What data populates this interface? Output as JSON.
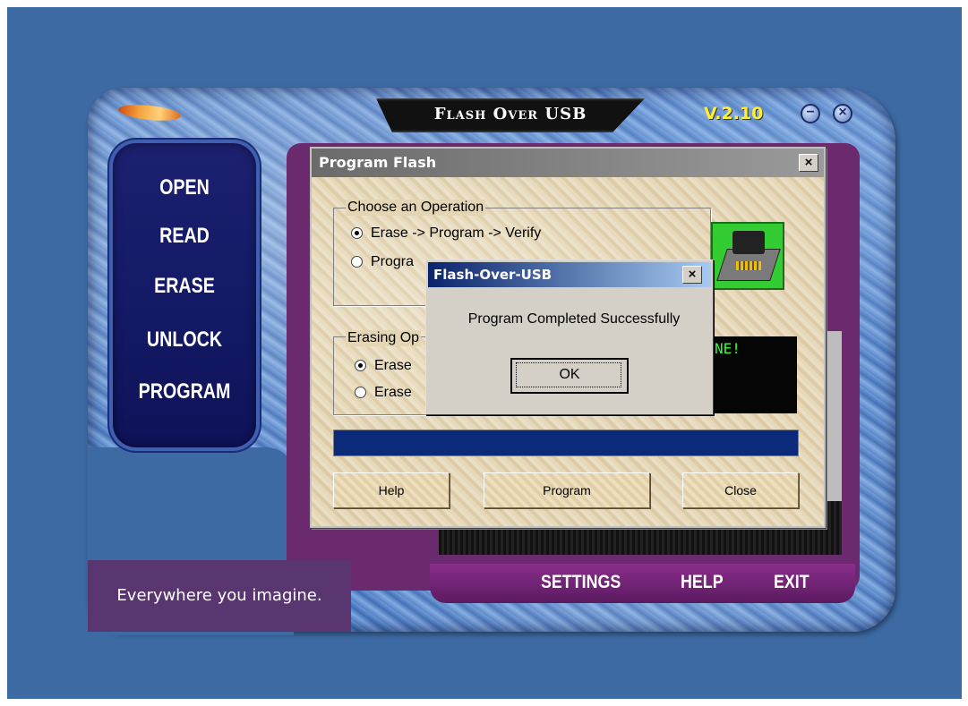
{
  "app": {
    "title": "Flash Over USB",
    "version": "V.2.10",
    "minimize_glyph": "−",
    "close_glyph": "×"
  },
  "nav": {
    "items": [
      {
        "label": "OPEN"
      },
      {
        "label": "READ"
      },
      {
        "label": "ERASE"
      },
      {
        "label": "UNLOCK"
      },
      {
        "label": "PROGRAM"
      }
    ]
  },
  "bottom_links": {
    "settings": "SETTINGS",
    "help": "HELP",
    "exit": "EXIT"
  },
  "slogan": "Everywhere you imagine.",
  "program_dialog": {
    "title": "Program Flash",
    "close_glyph": "×",
    "operation_group": {
      "label": "Choose an Operation",
      "options": [
        {
          "label": "Erase -> Program -> Verify",
          "checked": true
        },
        {
          "label": "Progra",
          "checked": false
        }
      ]
    },
    "erasing_group": {
      "label": "Erasing Op",
      "options": [
        {
          "label": "Erase",
          "checked": true
        },
        {
          "label": "Erase",
          "checked": false
        }
      ]
    },
    "status_text": "NE!",
    "buttons": {
      "help": "Help",
      "program": "Program",
      "close": "Close"
    },
    "icon": "chip-programmer-icon"
  },
  "message_box": {
    "title": "Flash-Over-USB",
    "close_glyph": "×",
    "message": "Program Completed Successfully",
    "ok_label": "OK"
  },
  "colors": {
    "desktop": "#3d6aa3",
    "nav_panel": "#141a66",
    "accent_purple": "#6b2a6e",
    "version_yellow": "#ffee33",
    "msg_titlebar": "#0a246a"
  }
}
